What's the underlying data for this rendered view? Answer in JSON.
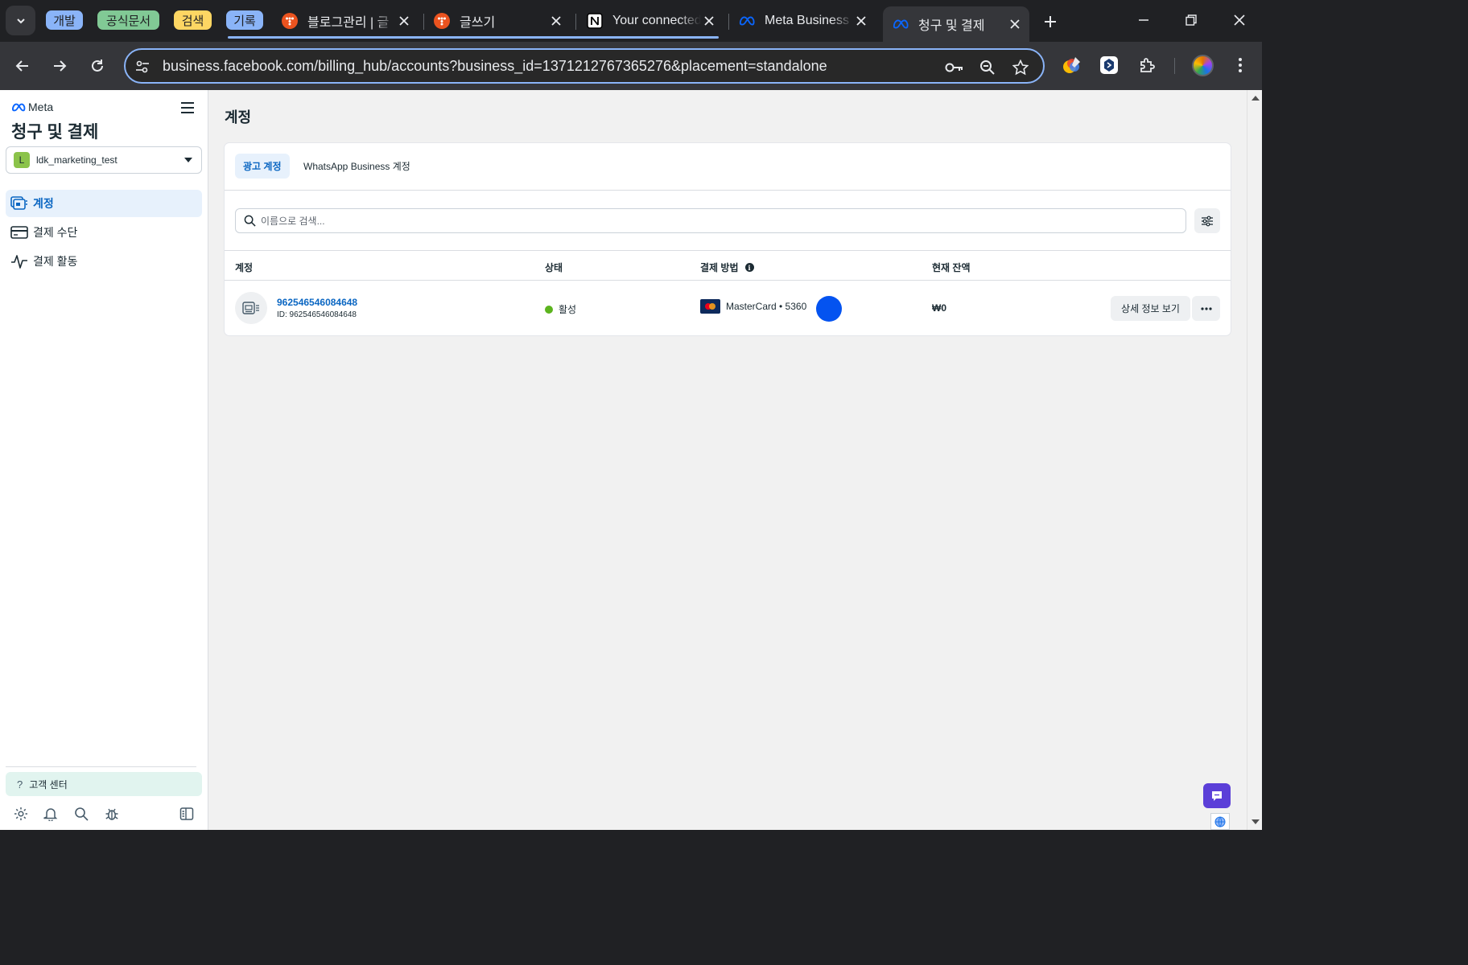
{
  "browser": {
    "tab_groups": [
      {
        "label": "개발",
        "color": "#8ab4f8"
      },
      {
        "label": "공식문서",
        "color": "#81c995"
      },
      {
        "label": "검색",
        "color": "#fdd663"
      },
      {
        "label": "기록",
        "color": "#8ab4f8"
      }
    ],
    "tabs": [
      {
        "title": "블로그관리 | 글",
        "icon": "tistory-icon"
      },
      {
        "title": "글쓰기",
        "icon": "tistory-icon"
      },
      {
        "title": "Your connected",
        "icon": "notion-icon"
      },
      {
        "title": "Meta Business",
        "icon": "meta-icon"
      },
      {
        "title": "청구 및 결제",
        "icon": "meta-icon",
        "active": true
      }
    ],
    "url": "business.facebook.com/billing_hub/accounts?business_id=1371212767365276&placement=standalone"
  },
  "sidebar": {
    "brand": "Meta",
    "title": "청구 및 결제",
    "business": {
      "initial": "L",
      "name": "ldk_marketing_test"
    },
    "nav_items": [
      {
        "label": "계정",
        "icon": "accounts-icon",
        "active": true
      },
      {
        "label": "결제 수단",
        "icon": "credit-card-icon"
      },
      {
        "label": "결제 활동",
        "icon": "activity-icon"
      }
    ],
    "help_label": "고객 센터"
  },
  "main": {
    "title": "계정",
    "tabs": [
      "광고 계정",
      "WhatsApp Business 계정"
    ],
    "search_placeholder": "이름으로 검색...",
    "columns": [
      "계정",
      "상태",
      "결제 방법",
      "현재 잔액"
    ],
    "rows": [
      {
        "account_name": "962546546084648",
        "account_id": "ID: 962546546084648",
        "status": "활성",
        "status_color": "#5cb41e",
        "payment_method": "MasterCard • 5360",
        "balance": "₩0",
        "detail_label": "상세 정보 보기"
      }
    ]
  }
}
